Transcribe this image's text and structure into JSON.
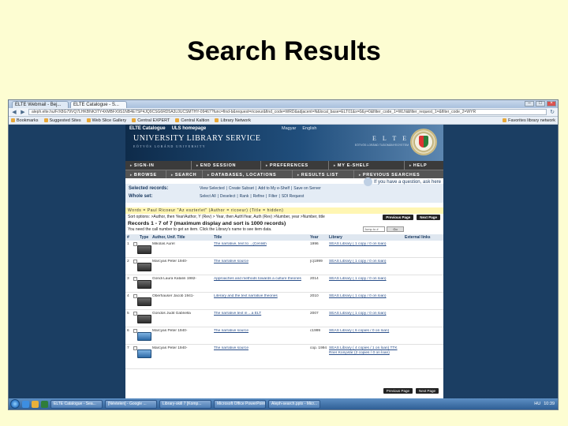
{
  "slide": {
    "title": "Search Results"
  },
  "browser": {
    "tabs": [
      "ELTE Webmail - Bej...",
      "ELTE Catalogue - S..."
    ],
    "url": "aleph.elte.hu/F/X8G79VQ7LHKBNK3TY4XMBFX9S1NB4E7SP4JQ9CSG6RD5A3L0UCSMTHY-09467?func=find-b&request=ricoeur&find_code=WRD&adjacent=N&local_base=ELT01&x=0&y=0&filter_code_1=WLN&filter_request_1=&filter_code_2=WYR",
    "bookmarks": [
      "Bookmarks",
      "Suggested Sites",
      "Web Slice Gallery",
      "Central EXPERT",
      "Central Kaltion",
      "Library Network"
    ],
    "bookmark_right": "Favorites library network"
  },
  "catalogue": {
    "header_links": [
      "ELTE Catalogue",
      "ULS homepage"
    ],
    "header_right": [
      "Magyar",
      "English"
    ],
    "brand": "UNIVERSITY LIBRARY SERVICE",
    "brand_sub": "EÖTVÖS LORÁND UNIVERSITY",
    "elte": "E L T E",
    "elte_sub": "EÖTVÖS LORÁND TUDOMÁNYEGYETEM",
    "nav_top": [
      "SIGN-IN",
      "END SESSION",
      "PREFERENCES",
      "MY E-SHELF",
      "HELP"
    ],
    "nav_bottom": [
      "BROWSE",
      "SEARCH",
      "DATABASES, LOCATIONS",
      "RESULTS LIST",
      "PREVIOUS SEARCHES"
    ],
    "selected_records_label": "Selected records:",
    "whole_set_label": "Whole set:",
    "selected_actions": [
      "View Selected",
      "|",
      "Create Subset",
      "|",
      "Add to My e-Shelf",
      "|",
      "Save on Server"
    ],
    "whole_set_actions": [
      "Select All",
      "|",
      "Deselect",
      "|",
      "Rank",
      "|",
      "Refine",
      "|",
      "Filter",
      "|",
      "SDI Request"
    ],
    "question": "If you have a question, ask here",
    "search_line": "Words = Paul Ricoeur \"Az eszterlet\" (Author = ricoeur) (Title = hidden)",
    "sort_line": "Sort options: >Author, then Year\\Author, Y (Rev) > Year, then Auth\\Year, Auth (Rev) >Number, year >Number, title",
    "records_line": "Records 1 - 7 of 7 (maximum display and sort is 1000 records)",
    "callnum_line": "You need the call number to get an item. Click the Library's name to see item data.",
    "jump_input": "Jump to #",
    "jump_btn": "Go",
    "prev_page": "Previous Page",
    "next_page": "Next Page",
    "columns": [
      "#",
      "Type",
      "Author, Unif. Title",
      "Title",
      "Year",
      "Library",
      "External links"
    ],
    "rows": [
      {
        "num": "1",
        "icon": "dark",
        "author": "Mikolas Aurel",
        "title": "The narrative, text to ...(Cenlish",
        "year": "1996",
        "library": "SEAS Library ( 1 copy / 0 on loan)"
      },
      {
        "num": "2",
        "icon": "dark",
        "author": "Marcyas Peter 1940-",
        "title": "The narrative source",
        "year": "[c]1999",
        "library": "SEAS Library ( 1 copy / 0 on loan)"
      },
      {
        "num": "3",
        "icon": "dark",
        "author": "Gondi Laura Katalin 1982-",
        "title": "Approaches and methods towards a culture theories",
        "year": "2014",
        "library": "SEAS Library ( 1 copy / 0 on loan)"
      },
      {
        "num": "4",
        "icon": "dark",
        "author": "Oberhauser Jacob 1941-",
        "title": "Literary and the text narrative theories",
        "year": "2010",
        "library": "SEAS Library ( 1 copy / 0 on loan)"
      },
      {
        "num": "5",
        "icon": "dark",
        "author": "Gondos Judit Gabriella",
        "title": "The narrative text in ...a ELT",
        "year": "2007",
        "library": "SEAS Library ( 1 copy / 0 on loan)"
      },
      {
        "num": "6",
        "icon": "blue",
        "author": "Marcyas Peter 1940-",
        "title": "The narrative source",
        "year": "c1999",
        "library": "SEAS Library ( 6 copies / 0 on loan)"
      },
      {
        "num": "7",
        "icon": "blue",
        "author": "Marcyas Peter 1940-",
        "title": "The narrative source",
        "year": "cop. 1994",
        "library": "SEAS Library ( 4 copies / 1 on loan) TTK Rner Konyvtár (2 copies / 0 on loan)"
      }
    ]
  },
  "taskbar": {
    "buttons": [
      "ELTE Catalogue - Sea...",
      "[Névtelen] - Google ...",
      "Library-skill 7 [Komp...",
      "Microsoft Office PowerPoint...",
      "Aleph-search.pptx - Micr..."
    ],
    "lang": "HU",
    "time": "10:39"
  }
}
